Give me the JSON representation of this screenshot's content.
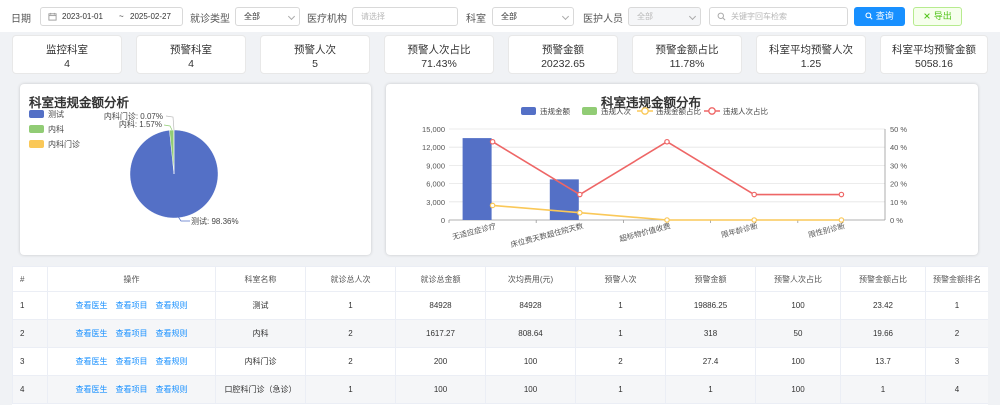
{
  "filters": {
    "date_label": "日期",
    "date_start": "2023-01-01",
    "date_sep": "~",
    "date_end": "2025-02-27",
    "visit_type_label": "就诊类型",
    "visit_type_value": "全部",
    "institution_label": "医疗机构",
    "institution_placeholder": "请选择",
    "dept_label": "科室",
    "dept_value": "全部",
    "staff_label": "医护人员",
    "staff_value": "全部",
    "search_placeholder": "关键字回车检索",
    "query_button": "查询",
    "export_button": "导出"
  },
  "stats": [
    {
      "title": "监控科室",
      "value": "4"
    },
    {
      "title": "预警科室",
      "value": "4"
    },
    {
      "title": "预警人次",
      "value": "5"
    },
    {
      "title": "预警人次占比",
      "value": "71.43%"
    },
    {
      "title": "预警金额",
      "value": "20232.65"
    },
    {
      "title": "预警金额占比",
      "value": "11.78%"
    },
    {
      "title": "科室平均预警人次",
      "value": "1.25"
    },
    {
      "title": "科室平均预警金额",
      "value": "5058.16"
    }
  ],
  "chart_data": [
    {
      "type": "pie",
      "title": "科室违规金额分析",
      "legend_position": "top-left",
      "slices": [
        {
          "name": "测试",
          "value": 98.36,
          "label": "测试: 98.36%",
          "color": "#5470c6"
        },
        {
          "name": "内科",
          "value": 1.57,
          "label": "内科: 1.57%",
          "color": "#91cc75"
        },
        {
          "name": "内科门诊",
          "value": 0.07,
          "label": "内科门诊: 0.07%",
          "color": "#fac858"
        }
      ]
    },
    {
      "type": "bar",
      "title": "科室违规金额分布",
      "legend_position": "top-center",
      "categories": [
        "无适应症诊疗",
        "床位费天数超住院天数",
        "超标物价值收费",
        "限年龄诊断",
        "限性别诊断"
      ],
      "series": [
        {
          "name": "违规金额",
          "kind": "bar",
          "axis": "left",
          "color": "#5470c6",
          "values": [
            13500,
            6700,
            0,
            0,
            0
          ]
        },
        {
          "name": "违规人次",
          "kind": "bar",
          "axis": "left",
          "color": "#91cc75",
          "values": [
            1,
            2,
            0,
            0,
            0
          ]
        },
        {
          "name": "违规金额占比",
          "kind": "line",
          "axis": "right",
          "color": "#fac858",
          "values": [
            8,
            4,
            0,
            0,
            0
          ]
        },
        {
          "name": "违规人次占比",
          "kind": "line",
          "axis": "right",
          "color": "#ee6666",
          "values": [
            43,
            14,
            43,
            14,
            14
          ]
        }
      ],
      "ylim_left": [
        0,
        15000
      ],
      "yticks_left": [
        "0",
        "3,000",
        "6,000",
        "9,000",
        "12,000",
        "15,000"
      ],
      "ylim_right": [
        0,
        50
      ],
      "yticks_right": [
        "0 %",
        "10 %",
        "20 %",
        "30 %",
        "40 %",
        "50 %"
      ],
      "grid": true
    }
  ],
  "table": {
    "columns": [
      "#",
      "操作",
      "科室名称",
      "就诊总人次",
      "就诊总金额",
      "次均费用(元)",
      "预警人次",
      "预警金额",
      "预警人次占比",
      "预警金额占比",
      "预警金额排名"
    ],
    "actions": [
      "查看医生",
      "查看项目",
      "查看规则"
    ],
    "rows": [
      {
        "idx": "1",
        "dept": "测试",
        "visits": "1",
        "amount": "84928",
        "avg": "84928",
        "warn_visits": "1",
        "warn_amount": "19886.25",
        "warn_visit_pct": "100",
        "warn_amount_pct": "23.42",
        "rank": "1"
      },
      {
        "idx": "2",
        "dept": "内科",
        "visits": "2",
        "amount": "1617.27",
        "avg": "808.64",
        "warn_visits": "1",
        "warn_amount": "318",
        "warn_visit_pct": "50",
        "warn_amount_pct": "19.66",
        "rank": "2"
      },
      {
        "idx": "3",
        "dept": "内科门诊",
        "visits": "2",
        "amount": "200",
        "avg": "100",
        "warn_visits": "2",
        "warn_amount": "27.4",
        "warn_visit_pct": "100",
        "warn_amount_pct": "13.7",
        "rank": "3"
      },
      {
        "idx": "4",
        "dept": "口腔科门诊（急诊）",
        "visits": "1",
        "amount": "100",
        "avg": "100",
        "warn_visits": "1",
        "warn_amount": "1",
        "warn_visit_pct": "100",
        "warn_amount_pct": "1",
        "rank": "4"
      }
    ]
  }
}
